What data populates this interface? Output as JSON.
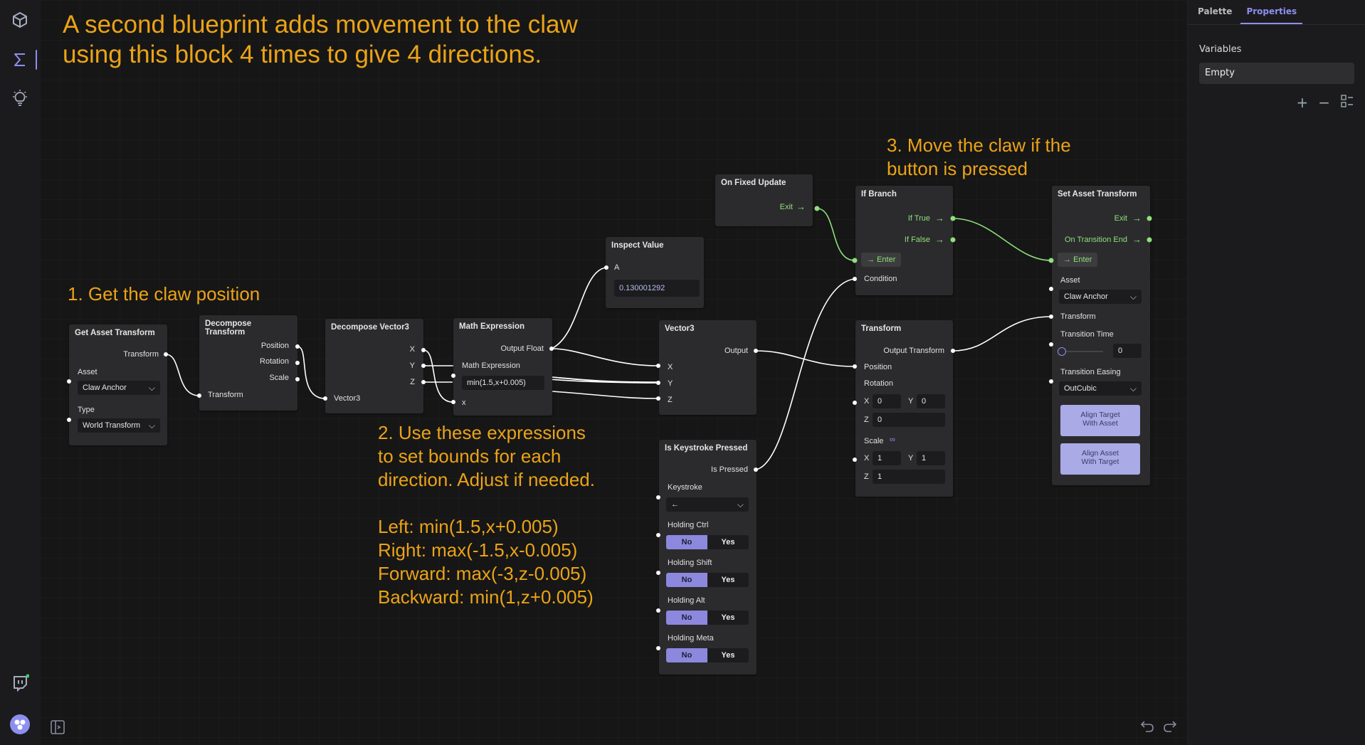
{
  "sidebar": {
    "items": [
      {
        "icon": "cube-icon",
        "active": false
      },
      {
        "icon": "sigma-icon",
        "active": true
      },
      {
        "icon": "lightbulb-icon",
        "active": false
      }
    ],
    "bottom": [
      {
        "icon": "twitch-icon"
      },
      {
        "icon": "user-avatar-icon"
      },
      {
        "icon": "sidebar-toggle-icon"
      }
    ]
  },
  "right_panel": {
    "tabs": [
      {
        "label": "Palette",
        "active": false
      },
      {
        "label": "Properties",
        "active": true
      }
    ],
    "section_title": "Variables",
    "variables_value": "Empty",
    "icons": [
      "plus-icon",
      "minus-icon",
      "layout-icon"
    ]
  },
  "annotations": {
    "header": "A second blueprint adds movement to the claw\nusing this block 4 times to give 4 directions.",
    "step1": "1. Get the claw position",
    "step2": "2. Use these expressions\nto set bounds for each\ndirection. Adjust if needed.\n\nLeft: min(1.5,x+0.005)\nRight: max(-1.5,x-0.005)\nForward: max(-3,z-0.005)\nBackward: min(1,z+0.005)",
    "step3": "3. Move the claw if the\nbutton is pressed"
  },
  "nodes": {
    "get_asset_transform": {
      "title": "Get Asset Transform",
      "out_transform": "Transform",
      "asset_label": "Asset",
      "asset_value": "Claw Anchor",
      "type_label": "Type",
      "type_value": "World Transform"
    },
    "decompose_transform": {
      "title": "Decompose Transform",
      "position": "Position",
      "rotation": "Rotation",
      "scale": "Scale",
      "in_transform": "Transform"
    },
    "decompose_vector3": {
      "title": "Decompose Vector3",
      "x": "X",
      "y": "Y",
      "z": "Z",
      "in_vector": "Vector3"
    },
    "math_expression": {
      "title": "Math Expression",
      "out": "Output Float",
      "expr_label": "Math Expression",
      "expr_value": "min(1.5,x+0.005)",
      "in_x": "x"
    },
    "inspect_value": {
      "title": "Inspect Value",
      "in_a": "A",
      "value": "0.130001292"
    },
    "vector3": {
      "title": "Vector3",
      "out": "Output",
      "x": "X",
      "y": "Y",
      "z": "Z"
    },
    "on_fixed_update": {
      "title": "On Fixed Update",
      "exit": "Exit"
    },
    "if_branch": {
      "title": "If Branch",
      "if_true": "If True",
      "if_false": "If False",
      "enter": "Enter",
      "condition": "Condition"
    },
    "transform": {
      "title": "Transform",
      "out": "Output Transform",
      "position": "Position",
      "rotation": "Rotation",
      "rx": "0",
      "ry": "0",
      "rz": "0",
      "scale": "Scale",
      "sx": "1",
      "sy": "1",
      "sz": "1",
      "x_lbl": "X",
      "y_lbl": "Y",
      "z_lbl": "Z"
    },
    "set_asset_transform": {
      "title": "Set Asset Transform",
      "exit": "Exit",
      "on_transition_end": "On Transition End",
      "enter": "Enter",
      "asset_label": "Asset",
      "asset_value": "Claw Anchor",
      "transform_label": "Transform",
      "transition_time_label": "Transition Time",
      "transition_time_value": "0",
      "transition_easing_label": "Transition Easing",
      "transition_easing_value": "OutCubic",
      "align_btn_1": "Align Target\nWith Asset",
      "align_btn_2": "Align Asset\nWith Target"
    },
    "is_keystroke_pressed": {
      "title": "Is Keystroke Pressed",
      "out": "Is Pressed",
      "keystroke_label": "Keystroke",
      "keystroke_value": "←",
      "holding_ctrl": "Holding Ctrl",
      "holding_shift": "Holding Shift",
      "holding_alt": "Holding Alt",
      "holding_meta": "Holding Meta",
      "no": "No",
      "yes": "Yes"
    }
  },
  "colors": {
    "accent": "#8d8ff0",
    "annotation": "#eba317",
    "exec_wire": "#8fe07c",
    "data_wire": "#ffffff",
    "node_bg": "#2b2b2d"
  }
}
